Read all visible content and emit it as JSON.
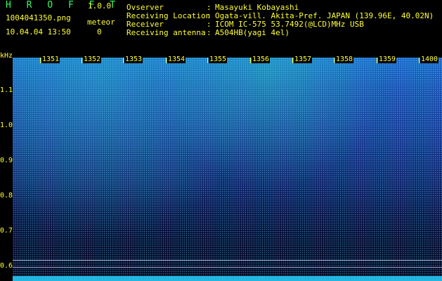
{
  "app": {
    "title": "H R O F F T",
    "version": "1.0.0"
  },
  "file": {
    "name": "1004041350.png",
    "datetime": "10.04.04 13:50"
  },
  "meteor": {
    "label": "meteor",
    "count": "0"
  },
  "info": {
    "observer_label": "Ovserver",
    "observer": "Masayuki Kobayashi",
    "location_label": "Receiving Location",
    "location": "Ogata-vill. Akita-Pref. JAPAN (139.96E, 40.02N)",
    "receiver_label": "Receiver",
    "receiver": "ICOM IC-575 53.7492(@LCD)MHz USB",
    "antenna_label": "Receiving antenna",
    "antenna": "A504HB(yagi 4el)",
    "colon": ":"
  },
  "axis": {
    "unit": "kHz",
    "y_labels": [
      "1.1",
      "1.0",
      "0.9",
      "0.8",
      "0.7",
      "0.6"
    ],
    "time_labels": [
      "1351",
      "1352",
      "1353",
      "1354",
      "1355",
      "1356",
      "1357",
      "1358",
      "1359",
      "1400"
    ]
  },
  "colors": {
    "label": "#ffff33",
    "title": "#33ff66",
    "spectrum_top": "#1a6acb",
    "spectrum_bottom": "#050820"
  }
}
